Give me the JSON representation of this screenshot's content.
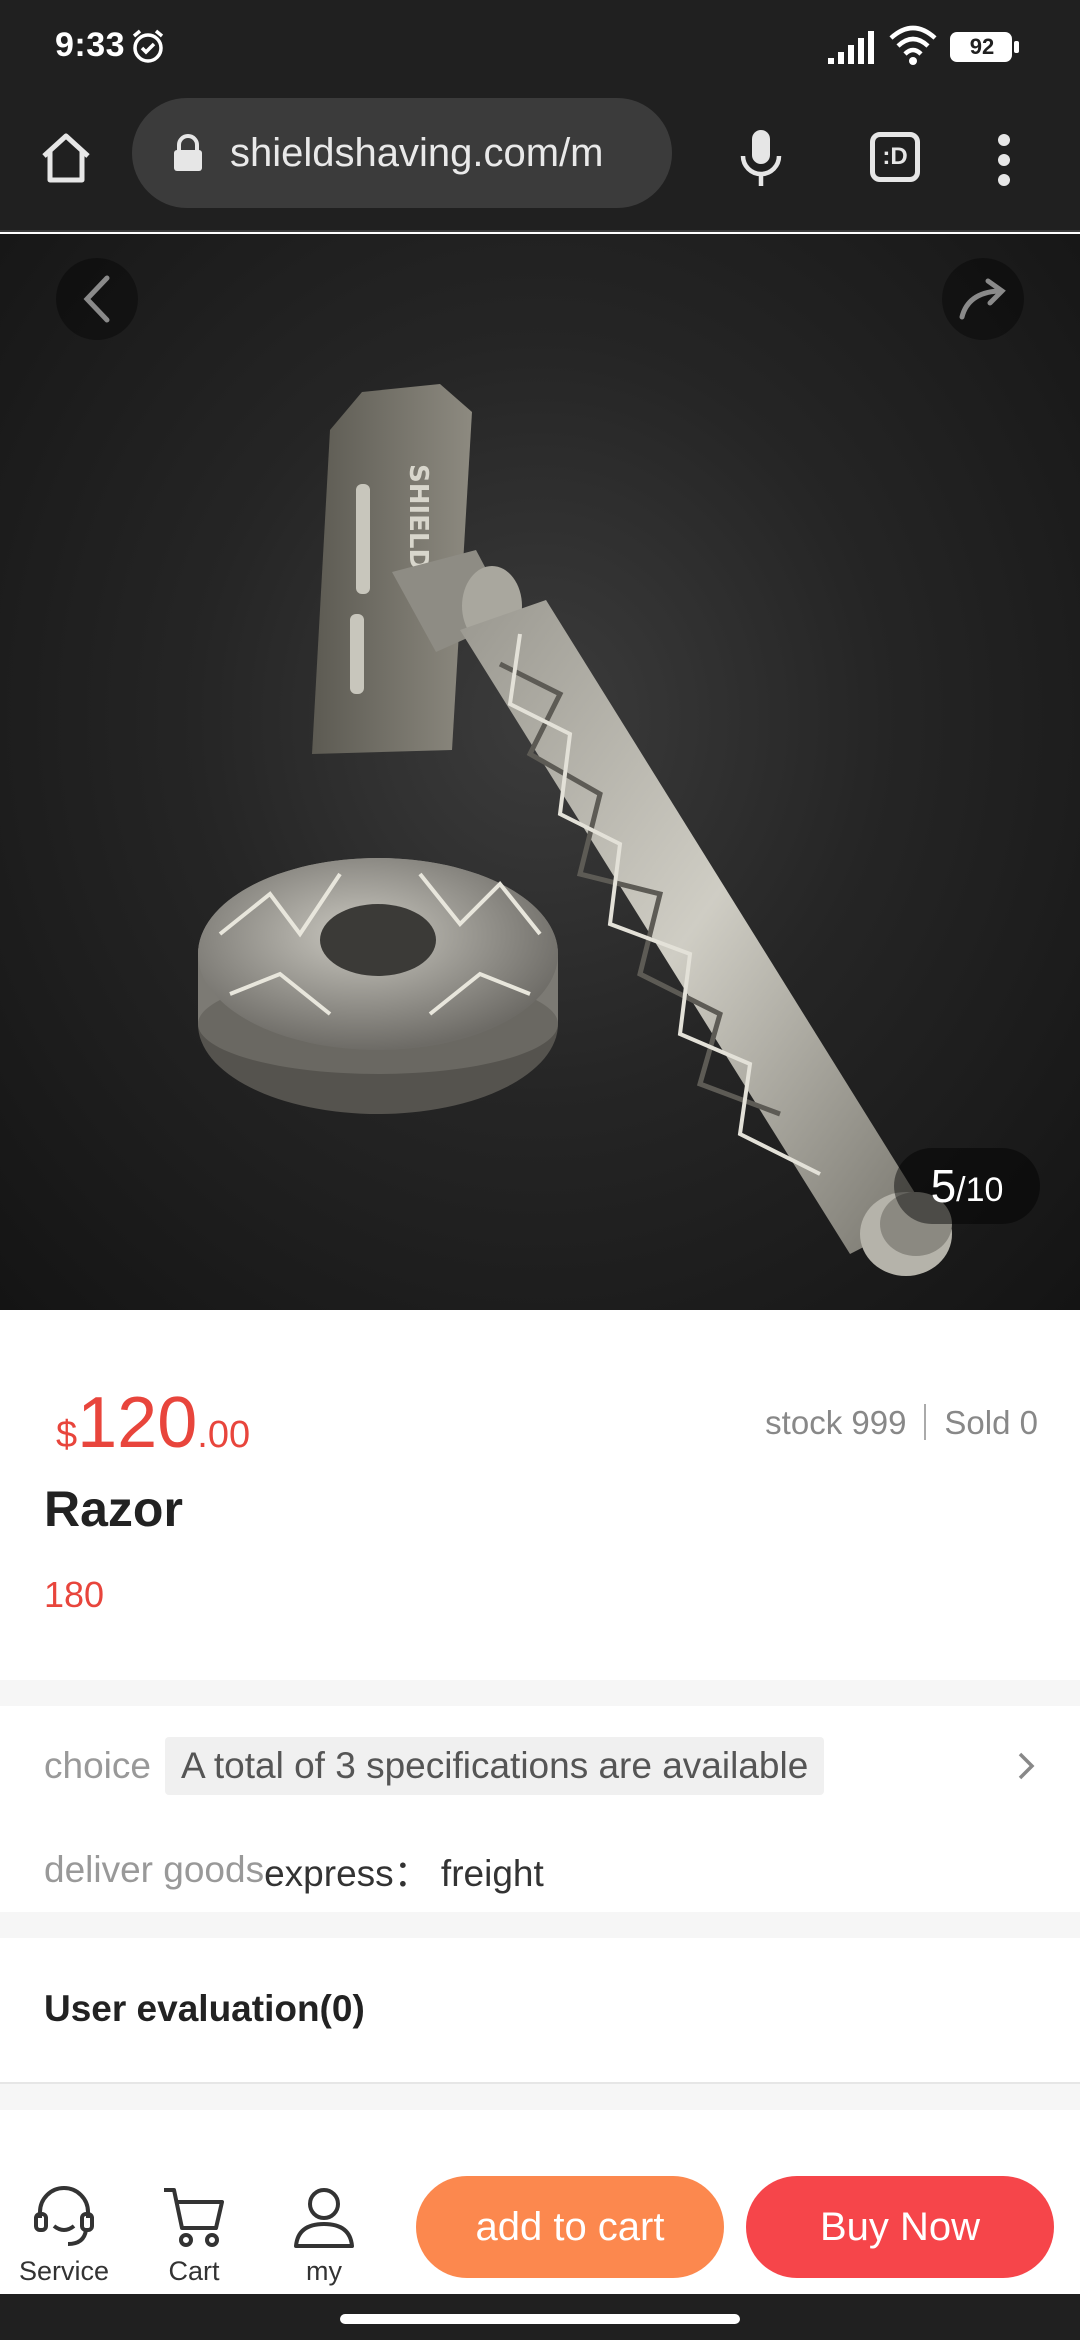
{
  "status_bar": {
    "time": "9:33",
    "battery": "92"
  },
  "browser": {
    "url": "shieldshaving.com/m",
    "tabs_label": ":D"
  },
  "gallery": {
    "current": "5",
    "total": "/10",
    "image_text": "SHIELD"
  },
  "product": {
    "currency": "$",
    "price_int": "120",
    "price_dec": ".00",
    "stock": "stock 999",
    "sold": "Sold 0",
    "title": "Razor",
    "subtitle": "180"
  },
  "specs": {
    "choice_label": "choice",
    "choice_value": "A total of 3 specifications are available",
    "deliver_label": "deliver goods",
    "deliver_value": "express： freight"
  },
  "evaluation": {
    "title": "User evaluation(0)"
  },
  "bottom_bar": {
    "service_label": "Service",
    "cart_label": "Cart",
    "my_label": "my",
    "add_to_cart": "add to cart",
    "buy_now": "Buy Now"
  },
  "colors": {
    "price": "#e8453c",
    "add_to_cart": "#fc884e",
    "buy_now": "#f6454a",
    "browser_chrome": "#202020"
  },
  "icons": [
    "alarm-icon",
    "signal-icon",
    "wifi-icon",
    "battery-icon",
    "home-icon",
    "lock-icon",
    "mic-icon",
    "tabs-icon",
    "more-vert-icon",
    "back-icon",
    "share-icon",
    "chevron-right-icon",
    "headset-icon",
    "cart-icon",
    "person-icon"
  ]
}
